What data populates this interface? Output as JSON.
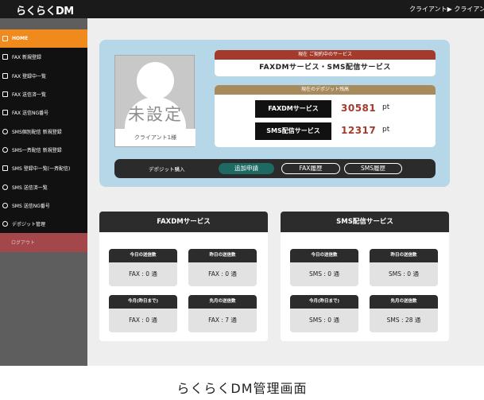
{
  "header": {
    "logo": "らくらくDM",
    "breadcrumb": "クライアント▶ クライアント"
  },
  "sidebar": {
    "items": [
      {
        "label": "HOME",
        "icon": "home-icon"
      },
      {
        "label": "FAX 新規登録",
        "icon": "fax-icon"
      },
      {
        "label": "FAX 登録中一覧",
        "icon": "list-icon"
      },
      {
        "label": "FAX 送信済一覧",
        "icon": "list-icon"
      },
      {
        "label": "FAX 送信NG番号",
        "icon": "list-icon"
      },
      {
        "label": "SMS個別配信 新規登録",
        "icon": "sms-icon"
      },
      {
        "label": "SMS一斉配信 新規登録",
        "icon": "sms-icon"
      },
      {
        "label": "SMS 登録中一覧(一斉配信)",
        "icon": "list-icon"
      },
      {
        "label": "SMS 送信済一覧",
        "icon": "sms-icon"
      },
      {
        "label": "SMS 送信NG番号",
        "icon": "sms-icon"
      },
      {
        "label": "デポジット管理",
        "icon": "coin-icon"
      },
      {
        "label": "ログアウト",
        "icon": ""
      }
    ]
  },
  "profile": {
    "placeholder_mark": "未設定",
    "name": "クライアント1様"
  },
  "contract": {
    "heading": "現在 ご契約中のサービス",
    "value": "FAXDMサービス・SMS配信サービス"
  },
  "deposit": {
    "heading": "現在のデポジット残高",
    "rows": [
      {
        "label": "FAXDMサービス",
        "value": "30581",
        "unit": "pt"
      },
      {
        "label": "SMS配信サービス",
        "value": "12317",
        "unit": "pt"
      }
    ]
  },
  "actions": {
    "label": "デポジット購入",
    "add": "追加申請",
    "fax_history": "FAX履歴",
    "sms_history": "SMS履歴"
  },
  "panels": [
    {
      "title": "FAXDMサービス",
      "stats": [
        {
          "label": "今日の送信数",
          "value": "FAX : 0 通"
        },
        {
          "label": "昨日の送信数",
          "value": "FAX : 0 通"
        },
        {
          "label": "今月(昨日まで)",
          "value": "FAX : 0 通"
        },
        {
          "label": "先月の送信数",
          "value": "FAX : 7 通"
        }
      ]
    },
    {
      "title": "SMS配信サービス",
      "stats": [
        {
          "label": "今日の送信数",
          "value": "SMS : 0 通"
        },
        {
          "label": "昨日の送信数",
          "value": "SMS : 0 通"
        },
        {
          "label": "今月(昨日まで)",
          "value": "SMS : 0 通"
        },
        {
          "label": "先月の送信数",
          "value": "SMS : 28 通"
        }
      ]
    }
  ],
  "caption": "らくらくDM管理画面",
  "colors": {
    "accent": "#f08a1c",
    "contract": "#a33a2c",
    "deposit": "#a88b5d",
    "action": "#1d6a63"
  }
}
